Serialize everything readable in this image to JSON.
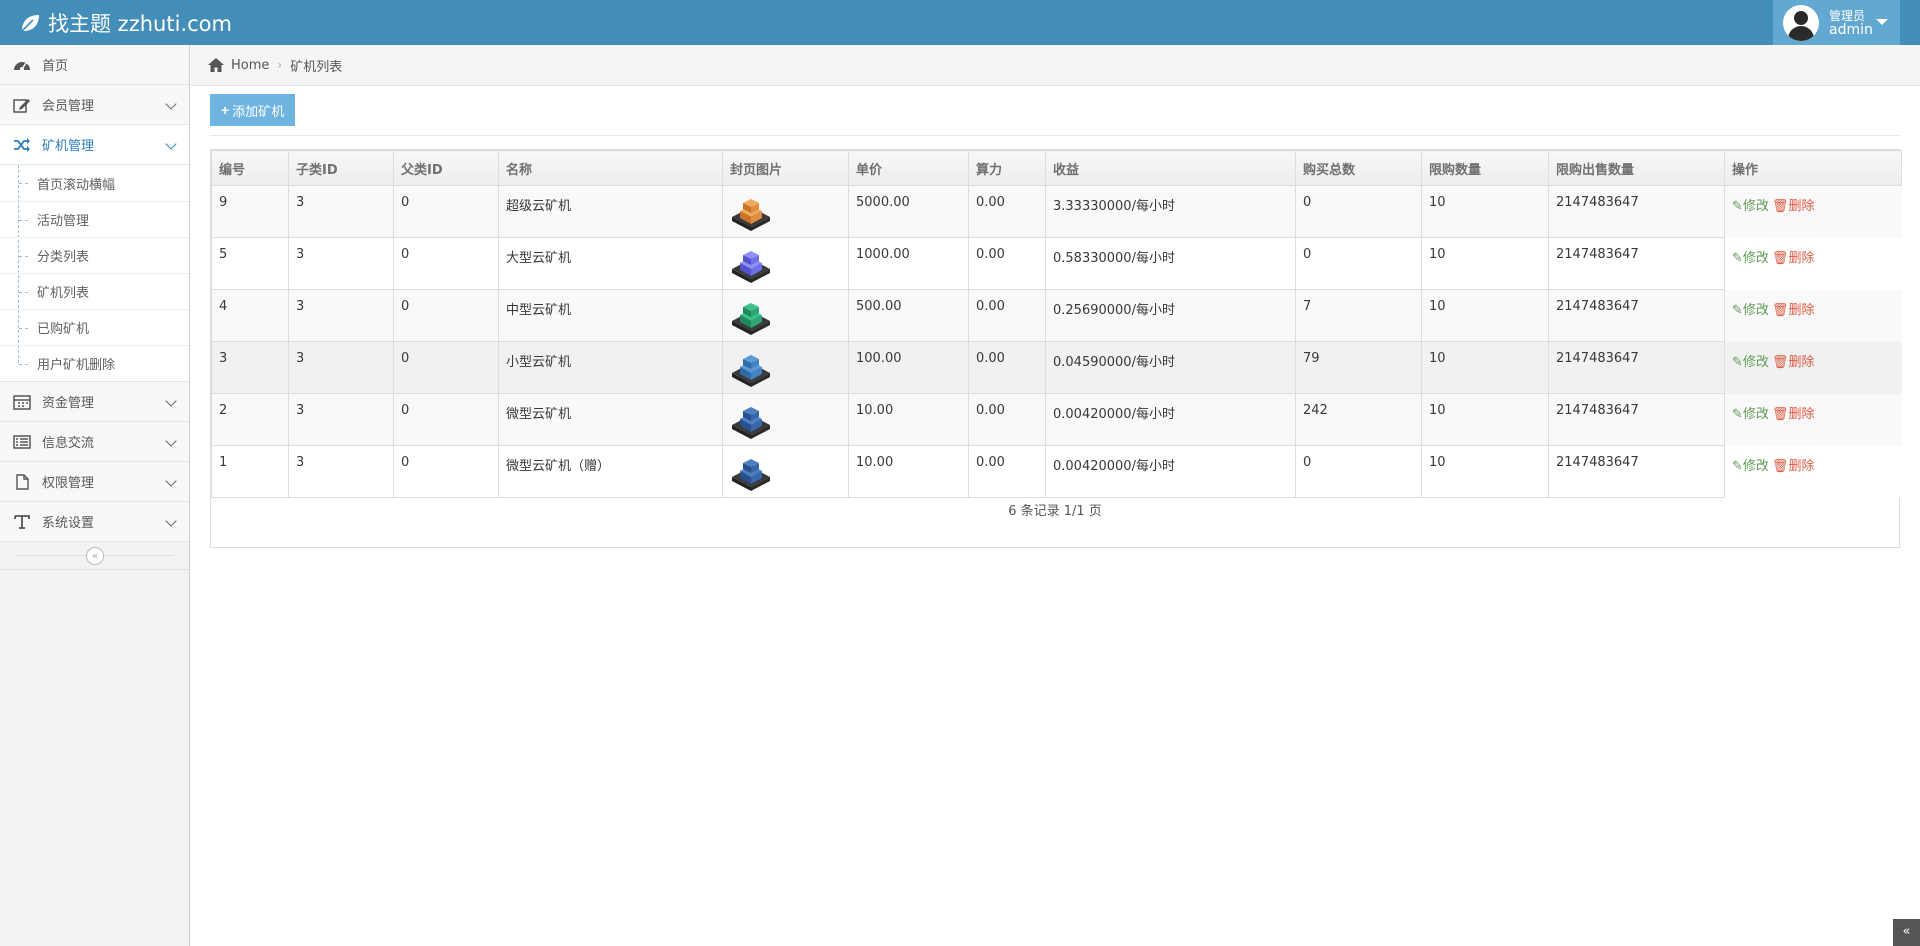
{
  "navbar": {
    "brand": "找主题 zzhuti.com",
    "user_role": "管理员",
    "user_name": "admin",
    "bg_color": "#438eb9"
  },
  "sidebar": {
    "items": [
      {
        "label": "首页",
        "icon": "dashboard-icon"
      },
      {
        "label": "会员管理",
        "icon": "edit-icon"
      },
      {
        "label": "矿机管理",
        "icon": "random-icon"
      },
      {
        "label": "资金管理",
        "icon": "calendar-icon"
      },
      {
        "label": "信息交流",
        "icon": "list-alt-icon"
      },
      {
        "label": "权限管理",
        "icon": "file-icon"
      },
      {
        "label": "系统设置",
        "icon": "text-icon"
      }
    ],
    "submenu": [
      "首页滚动横幅",
      "活动管理",
      "分类列表",
      "矿机列表",
      "已购矿机",
      "用户矿机删除"
    ],
    "collapse_label": "«"
  },
  "breadcrumb": {
    "home": "Home",
    "current": "矿机列表"
  },
  "toolbar": {
    "add_label": "添加矿机"
  },
  "table": {
    "columns": [
      "编号",
      "子类ID",
      "父类ID",
      "名称",
      "封页图片",
      "单价",
      "算力",
      "收益",
      "购买总数",
      "限购数量",
      "限购出售数量",
      "操作"
    ],
    "edit_label": "修改",
    "delete_label": "删除",
    "rows": [
      {
        "id": "9",
        "sub_id": "3",
        "parent_id": "0",
        "name": "超级云矿机",
        "image": "orange-cube",
        "price": "5000.00",
        "hash": "0.00",
        "profit": "3.33330000/每小时",
        "total": "0",
        "limit": "10",
        "limit_sell": "2147483647"
      },
      {
        "id": "5",
        "sub_id": "3",
        "parent_id": "0",
        "name": "大型云矿机",
        "image": "purple-cube",
        "price": "1000.00",
        "hash": "0.00",
        "profit": "0.58330000/每小时",
        "total": "0",
        "limit": "10",
        "limit_sell": "2147483647"
      },
      {
        "id": "4",
        "sub_id": "3",
        "parent_id": "0",
        "name": "中型云矿机",
        "image": "green-cube",
        "price": "500.00",
        "hash": "0.00",
        "profit": "0.25690000/每小时",
        "total": "7",
        "limit": "10",
        "limit_sell": "2147483647"
      },
      {
        "id": "3",
        "sub_id": "3",
        "parent_id": "0",
        "name": "小型云矿机",
        "image": "blue-cube",
        "price": "100.00",
        "hash": "0.00",
        "profit": "0.04590000/每小时",
        "total": "79",
        "limit": "10",
        "limit_sell": "2147483647"
      },
      {
        "id": "2",
        "sub_id": "3",
        "parent_id": "0",
        "name": "微型云矿机",
        "image": "navy-cube",
        "price": "10.00",
        "hash": "0.00",
        "profit": "0.00420000/每小时",
        "total": "242",
        "limit": "10",
        "limit_sell": "2147483647"
      },
      {
        "id": "1",
        "sub_id": "3",
        "parent_id": "0",
        "name": "微型云矿机（赠）",
        "image": "navy-cube",
        "price": "10.00",
        "hash": "0.00",
        "profit": "0.00420000/每小时",
        "total": "0",
        "limit": "10",
        "limit_sell": "2147483647"
      }
    ],
    "pagination": "6 条记录 1/1 页"
  },
  "scroll_top_label": "«"
}
